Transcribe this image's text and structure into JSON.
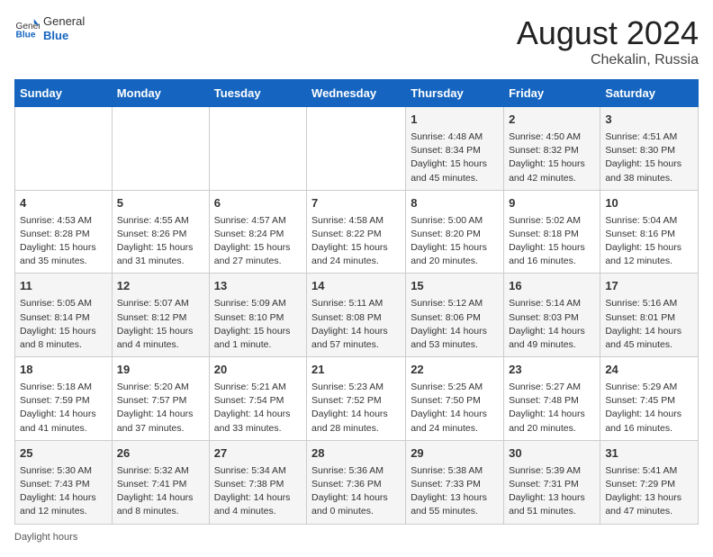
{
  "header": {
    "logo": {
      "general": "General",
      "blue": "Blue"
    },
    "month_year": "August 2024",
    "location": "Chekalin, Russia"
  },
  "weekdays": [
    "Sunday",
    "Monday",
    "Tuesday",
    "Wednesday",
    "Thursday",
    "Friday",
    "Saturday"
  ],
  "weeks": [
    [
      {
        "day": "",
        "info": ""
      },
      {
        "day": "",
        "info": ""
      },
      {
        "day": "",
        "info": ""
      },
      {
        "day": "",
        "info": ""
      },
      {
        "day": "1",
        "info": "Sunrise: 4:48 AM\nSunset: 8:34 PM\nDaylight: 15 hours and 45 minutes."
      },
      {
        "day": "2",
        "info": "Sunrise: 4:50 AM\nSunset: 8:32 PM\nDaylight: 15 hours and 42 minutes."
      },
      {
        "day": "3",
        "info": "Sunrise: 4:51 AM\nSunset: 8:30 PM\nDaylight: 15 hours and 38 minutes."
      }
    ],
    [
      {
        "day": "4",
        "info": "Sunrise: 4:53 AM\nSunset: 8:28 PM\nDaylight: 15 hours and 35 minutes."
      },
      {
        "day": "5",
        "info": "Sunrise: 4:55 AM\nSunset: 8:26 PM\nDaylight: 15 hours and 31 minutes."
      },
      {
        "day": "6",
        "info": "Sunrise: 4:57 AM\nSunset: 8:24 PM\nDaylight: 15 hours and 27 minutes."
      },
      {
        "day": "7",
        "info": "Sunrise: 4:58 AM\nSunset: 8:22 PM\nDaylight: 15 hours and 24 minutes."
      },
      {
        "day": "8",
        "info": "Sunrise: 5:00 AM\nSunset: 8:20 PM\nDaylight: 15 hours and 20 minutes."
      },
      {
        "day": "9",
        "info": "Sunrise: 5:02 AM\nSunset: 8:18 PM\nDaylight: 15 hours and 16 minutes."
      },
      {
        "day": "10",
        "info": "Sunrise: 5:04 AM\nSunset: 8:16 PM\nDaylight: 15 hours and 12 minutes."
      }
    ],
    [
      {
        "day": "11",
        "info": "Sunrise: 5:05 AM\nSunset: 8:14 PM\nDaylight: 15 hours and 8 minutes."
      },
      {
        "day": "12",
        "info": "Sunrise: 5:07 AM\nSunset: 8:12 PM\nDaylight: 15 hours and 4 minutes."
      },
      {
        "day": "13",
        "info": "Sunrise: 5:09 AM\nSunset: 8:10 PM\nDaylight: 15 hours and 1 minute."
      },
      {
        "day": "14",
        "info": "Sunrise: 5:11 AM\nSunset: 8:08 PM\nDaylight: 14 hours and 57 minutes."
      },
      {
        "day": "15",
        "info": "Sunrise: 5:12 AM\nSunset: 8:06 PM\nDaylight: 14 hours and 53 minutes."
      },
      {
        "day": "16",
        "info": "Sunrise: 5:14 AM\nSunset: 8:03 PM\nDaylight: 14 hours and 49 minutes."
      },
      {
        "day": "17",
        "info": "Sunrise: 5:16 AM\nSunset: 8:01 PM\nDaylight: 14 hours and 45 minutes."
      }
    ],
    [
      {
        "day": "18",
        "info": "Sunrise: 5:18 AM\nSunset: 7:59 PM\nDaylight: 14 hours and 41 minutes."
      },
      {
        "day": "19",
        "info": "Sunrise: 5:20 AM\nSunset: 7:57 PM\nDaylight: 14 hours and 37 minutes."
      },
      {
        "day": "20",
        "info": "Sunrise: 5:21 AM\nSunset: 7:54 PM\nDaylight: 14 hours and 33 minutes."
      },
      {
        "day": "21",
        "info": "Sunrise: 5:23 AM\nSunset: 7:52 PM\nDaylight: 14 hours and 28 minutes."
      },
      {
        "day": "22",
        "info": "Sunrise: 5:25 AM\nSunset: 7:50 PM\nDaylight: 14 hours and 24 minutes."
      },
      {
        "day": "23",
        "info": "Sunrise: 5:27 AM\nSunset: 7:48 PM\nDaylight: 14 hours and 20 minutes."
      },
      {
        "day": "24",
        "info": "Sunrise: 5:29 AM\nSunset: 7:45 PM\nDaylight: 14 hours and 16 minutes."
      }
    ],
    [
      {
        "day": "25",
        "info": "Sunrise: 5:30 AM\nSunset: 7:43 PM\nDaylight: 14 hours and 12 minutes."
      },
      {
        "day": "26",
        "info": "Sunrise: 5:32 AM\nSunset: 7:41 PM\nDaylight: 14 hours and 8 minutes."
      },
      {
        "day": "27",
        "info": "Sunrise: 5:34 AM\nSunset: 7:38 PM\nDaylight: 14 hours and 4 minutes."
      },
      {
        "day": "28",
        "info": "Sunrise: 5:36 AM\nSunset: 7:36 PM\nDaylight: 14 hours and 0 minutes."
      },
      {
        "day": "29",
        "info": "Sunrise: 5:38 AM\nSunset: 7:33 PM\nDaylight: 13 hours and 55 minutes."
      },
      {
        "day": "30",
        "info": "Sunrise: 5:39 AM\nSunset: 7:31 PM\nDaylight: 13 hours and 51 minutes."
      },
      {
        "day": "31",
        "info": "Sunrise: 5:41 AM\nSunset: 7:29 PM\nDaylight: 13 hours and 47 minutes."
      }
    ]
  ],
  "footer": {
    "daylight_label": "Daylight hours"
  }
}
